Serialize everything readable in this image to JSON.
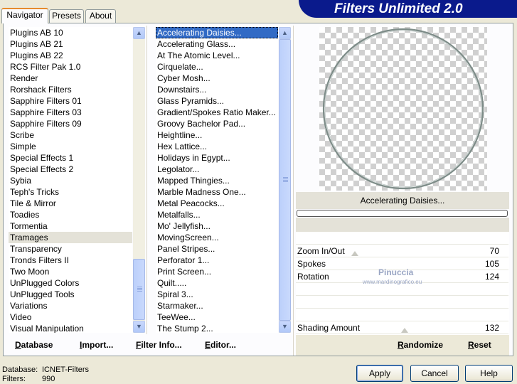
{
  "tabs": [
    "Navigator",
    "Presets",
    "About"
  ],
  "title": "Filters Unlimited 2.0",
  "categories": [
    "Plugins AB 10",
    "Plugins AB 21",
    "Plugins AB 22",
    "RCS Filter Pak 1.0",
    "Render",
    "Rorshack Filters",
    "Sapphire Filters 01",
    "Sapphire Filters 03",
    "Sapphire Filters 09",
    "Scribe",
    "Simple",
    "Special Effects 1",
    "Special Effects 2",
    "Sybia",
    "Teph's Tricks",
    "Tile & Mirror",
    "Toadies",
    "Tormentia",
    "Tramages",
    "Transparency",
    "Tronds Filters II",
    "Two Moon",
    "UnPlugged Colors",
    "UnPlugged Tools",
    "Variations",
    "Video",
    "Visual Manipulation"
  ],
  "filters": [
    "Accelerating Daisies...",
    "Accelerating Glass...",
    "At The Atomic Level...",
    "Cirquelate...",
    "Cyber Mosh...",
    "Downstairs...",
    "Glass Pyramids...",
    "Gradient/Spokes Ratio Maker...",
    "Groovy Bachelor Pad...",
    "Heightline...",
    "Hex Lattice...",
    "Holidays in Egypt...",
    "Legolator...",
    "Mapped Thingies...",
    "Marble Madness One...",
    "Metal Peacocks...",
    "Metalfalls...",
    "Mo' Jellyfish...",
    "MovingScreen...",
    "Panel Stripes...",
    "Perforator 1...",
    "Print Screen...",
    "Quilt.....",
    "Spiral 3...",
    "Starmaker...",
    "TeeWee...",
    "The Stump 2..."
  ],
  "selected_category": "Tramages",
  "selected_filter": "Accelerating Daisies...",
  "bottom_links": {
    "database": "Database",
    "import": "Import...",
    "filter_info": "Filter Info...",
    "editor": "Editor..."
  },
  "preview": {
    "filter_name": "Accelerating Daisies..."
  },
  "params": [
    {
      "label": "Zoom In/Out",
      "value": "70"
    },
    {
      "label": "Spokes",
      "value": "105"
    },
    {
      "label": "Rotation",
      "value": "124"
    },
    {
      "label": "Shading Amount",
      "value": "132"
    }
  ],
  "param_levels": {
    "zoom": 70,
    "spokes": 105,
    "rotation": 124,
    "shading": 132,
    "max": 255
  },
  "watermark": {
    "name": "Pinuccia",
    "site": "www.mardinografico.eu"
  },
  "actions": {
    "randomize": "Randomize",
    "reset": "Reset"
  },
  "status": {
    "database_label": "Database:",
    "database_value": "ICNET-Filters",
    "filters_label": "Filters:",
    "filters_value": "990"
  },
  "buttons": {
    "apply": "Apply",
    "cancel": "Cancel",
    "help": "Help"
  },
  "colors": {
    "accent": "#e68b2c",
    "banner": "#0a1a8c",
    "selection": "#316ac5"
  }
}
